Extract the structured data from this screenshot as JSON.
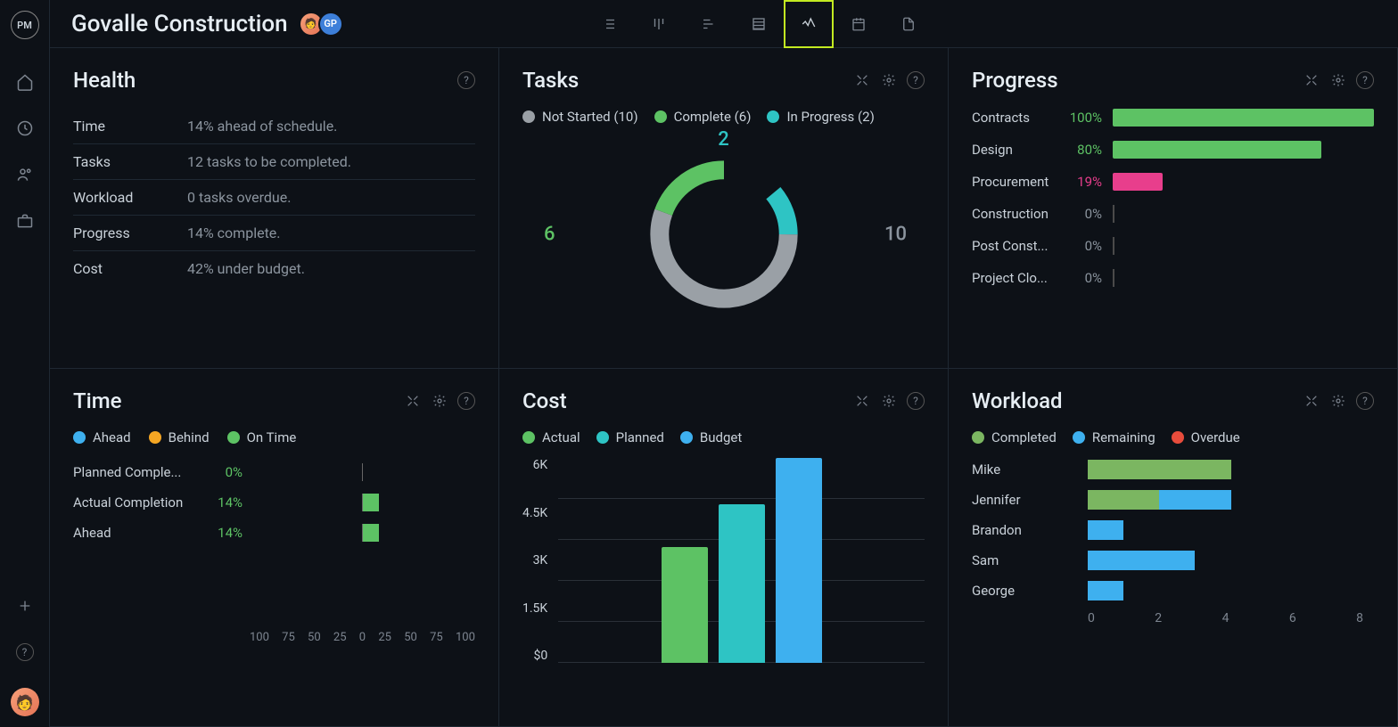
{
  "project_title": "Govalle Construction",
  "avatars": [
    "👤",
    "GP"
  ],
  "sidebar_logo": "PM",
  "views": [
    "list",
    "board",
    "gantt",
    "sheet",
    "dashboard",
    "calendar",
    "files"
  ],
  "active_view": "dashboard",
  "panels": {
    "health": {
      "title": "Health",
      "rows": [
        {
          "label": "Time",
          "value": "14% ahead of schedule."
        },
        {
          "label": "Tasks",
          "value": "12 tasks to be completed."
        },
        {
          "label": "Workload",
          "value": "0 tasks overdue."
        },
        {
          "label": "Progress",
          "value": "14% complete."
        },
        {
          "label": "Cost",
          "value": "42% under budget."
        }
      ]
    },
    "tasks": {
      "title": "Tasks",
      "legend": [
        {
          "label": "Not Started",
          "count": 10,
          "color": "#9aa0a6"
        },
        {
          "label": "Complete",
          "count": 6,
          "color": "#5dc264"
        },
        {
          "label": "In Progress",
          "count": 2,
          "color": "#2ec4c4"
        }
      ],
      "chart_data": {
        "type": "pie",
        "title": "Tasks",
        "series": [
          {
            "name": "Not Started",
            "value": 10,
            "color": "#9aa0a6"
          },
          {
            "name": "Complete",
            "value": 6,
            "color": "#5dc264"
          },
          {
            "name": "In Progress",
            "value": 2,
            "color": "#2ec4c4"
          }
        ],
        "total": 18,
        "labels": {
          "top": "2",
          "left": "6",
          "right": "10"
        }
      }
    },
    "progress": {
      "title": "Progress",
      "rows": [
        {
          "name": "Contracts",
          "pct": 100,
          "color": "#5dc264"
        },
        {
          "name": "Design",
          "pct": 80,
          "color": "#5dc264"
        },
        {
          "name": "Procurement",
          "pct": 19,
          "color": "#e83e8c"
        },
        {
          "name": "Construction",
          "pct": 0,
          "color": "#888"
        },
        {
          "name": "Post Const...",
          "pct": 0,
          "color": "#888"
        },
        {
          "name": "Project Clo...",
          "pct": 0,
          "color": "#888"
        }
      ]
    },
    "time": {
      "title": "Time",
      "legend": [
        {
          "label": "Ahead",
          "color": "#3eb0ef"
        },
        {
          "label": "Behind",
          "color": "#f5a623"
        },
        {
          "label": "On Time",
          "color": "#5dc264"
        }
      ],
      "rows": [
        {
          "name": "Planned Comple...",
          "pct": 0
        },
        {
          "name": "Actual Completion",
          "pct": 14
        },
        {
          "name": "Ahead",
          "pct": 14
        }
      ],
      "axis": [
        "100",
        "75",
        "50",
        "25",
        "0",
        "25",
        "50",
        "75",
        "100"
      ]
    },
    "cost": {
      "title": "Cost",
      "legend": [
        {
          "label": "Actual",
          "color": "#5dc264"
        },
        {
          "label": "Planned",
          "color": "#2ec4c4"
        },
        {
          "label": "Budget",
          "color": "#3eb0ef"
        }
      ],
      "chart_data": {
        "type": "bar",
        "categories": [
          "Actual",
          "Planned",
          "Budget"
        ],
        "values": [
          3400,
          4650,
          6000
        ],
        "ylim": [
          0,
          6000
        ],
        "ylabel": "",
        "xlabel": "",
        "yticks": [
          "6K",
          "4.5K",
          "3K",
          "1.5K",
          "$0"
        ]
      }
    },
    "workload": {
      "title": "Workload",
      "legend": [
        {
          "label": "Completed",
          "color": "#7bb661"
        },
        {
          "label": "Remaining",
          "color": "#3eb0ef"
        },
        {
          "label": "Overdue",
          "color": "#e74c3c"
        }
      ],
      "rows": [
        {
          "name": "Mike",
          "completed": 4,
          "remaining": 0,
          "overdue": 0
        },
        {
          "name": "Jennifer",
          "completed": 2,
          "remaining": 2,
          "overdue": 0
        },
        {
          "name": "Brandon",
          "completed": 0,
          "remaining": 1,
          "overdue": 0
        },
        {
          "name": "Sam",
          "completed": 0,
          "remaining": 3,
          "overdue": 0
        },
        {
          "name": "George",
          "completed": 0,
          "remaining": 1,
          "overdue": 0
        }
      ],
      "axis": [
        "0",
        "2",
        "4",
        "6",
        "8"
      ],
      "max": 8
    }
  },
  "chart_data": [
    {
      "panel": "tasks",
      "type": "pie",
      "series": [
        {
          "name": "Not Started",
          "value": 10
        },
        {
          "name": "Complete",
          "value": 6
        },
        {
          "name": "In Progress",
          "value": 2
        }
      ]
    },
    {
      "panel": "progress",
      "type": "bar",
      "categories": [
        "Contracts",
        "Design",
        "Procurement",
        "Construction",
        "Post Construction",
        "Project Closure"
      ],
      "values": [
        100,
        80,
        19,
        0,
        0,
        0
      ],
      "ylim": [
        0,
        100
      ],
      "xlabel": "",
      "ylabel": "%"
    },
    {
      "panel": "time",
      "type": "bar",
      "categories": [
        "Planned Completion",
        "Actual Completion",
        "Ahead"
      ],
      "values": [
        0,
        14,
        14
      ],
      "xlim": [
        -100,
        100
      ]
    },
    {
      "panel": "cost",
      "type": "bar",
      "categories": [
        "Actual",
        "Planned",
        "Budget"
      ],
      "values": [
        3400,
        4650,
        6000
      ],
      "ylim": [
        0,
        6000
      ]
    },
    {
      "panel": "workload",
      "type": "bar",
      "categories": [
        "Mike",
        "Jennifer",
        "Brandon",
        "Sam",
        "George"
      ],
      "series": [
        {
          "name": "Completed",
          "values": [
            4,
            2,
            0,
            0,
            0
          ]
        },
        {
          "name": "Remaining",
          "values": [
            0,
            2,
            1,
            3,
            1
          ]
        },
        {
          "name": "Overdue",
          "values": [
            0,
            0,
            0,
            0,
            0
          ]
        }
      ],
      "xlim": [
        0,
        8
      ]
    }
  ]
}
